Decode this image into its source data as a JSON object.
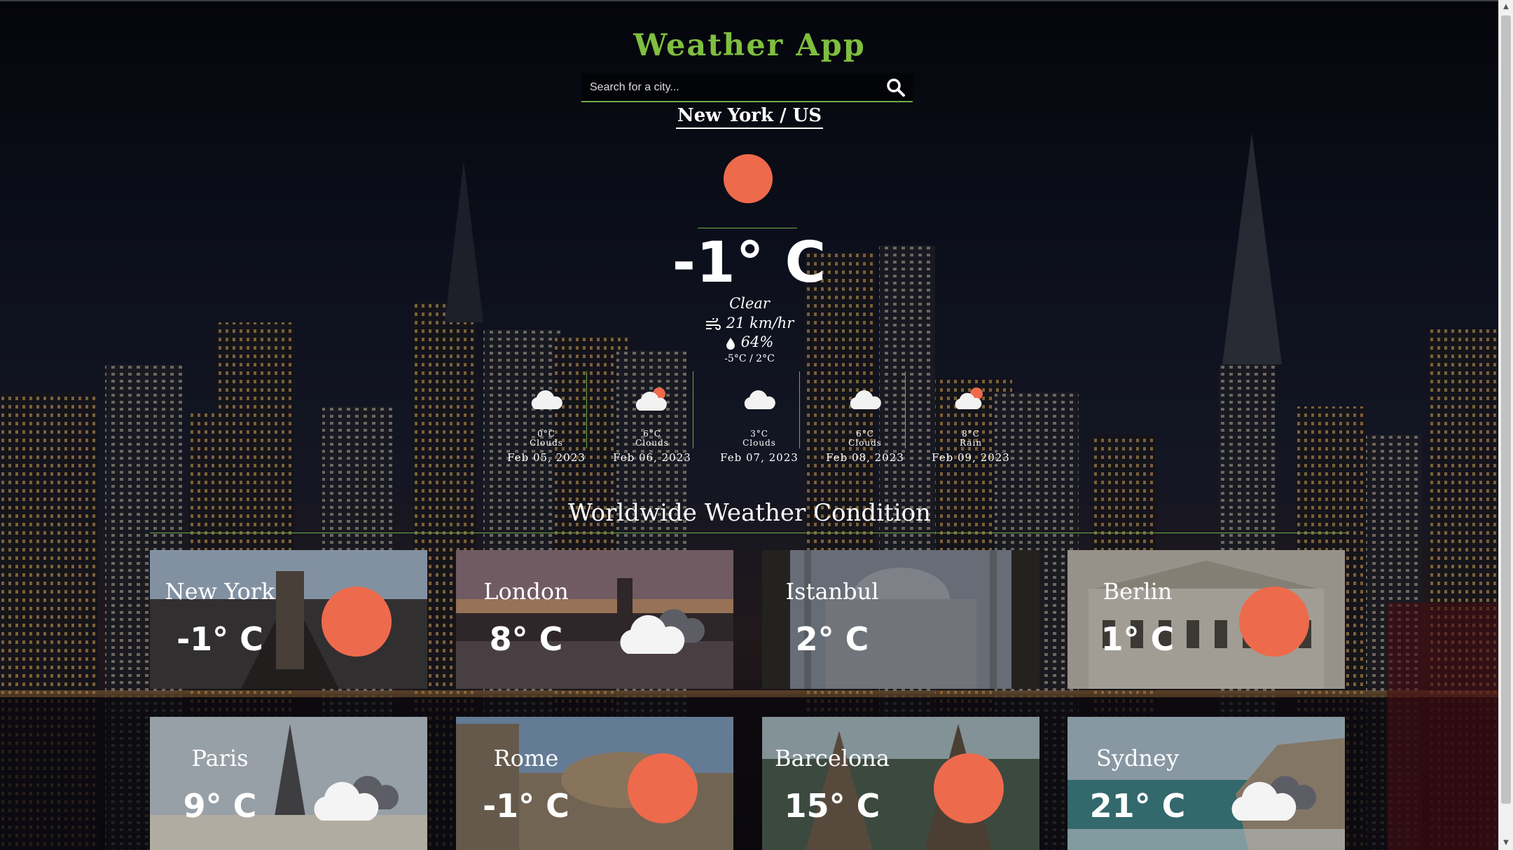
{
  "header": {
    "title": "Weather App"
  },
  "search": {
    "placeholder": "Search for a city..."
  },
  "current": {
    "location": "New York / US",
    "icon": "sun-icon",
    "temperature": "-1° C",
    "description": "Clear",
    "wind": "21 km/hr",
    "humidity": "64%",
    "range": "-5°C / 2°C"
  },
  "forecast": [
    {
      "temp": "0°C",
      "desc": "Clouds",
      "date": "Feb 05, 2023",
      "icon": "cloud-icon"
    },
    {
      "temp": "6°C",
      "desc": "Clouds",
      "date": "Feb 06, 2023",
      "icon": "cloud-sun-icon"
    },
    {
      "temp": "3°C",
      "desc": "Clouds",
      "date": "Feb 07, 2023",
      "icon": "cloud-icon"
    },
    {
      "temp": "6°C",
      "desc": "Clouds",
      "date": "Feb 08, 2023",
      "icon": "cloud-icon"
    },
    {
      "temp": "8°C",
      "desc": "Rain",
      "date": "Feb 09, 2023",
      "icon": "cloud-sun-icon"
    }
  ],
  "worldwide": {
    "title": "Worldwide Weather Condition",
    "cities": [
      {
        "name": "New York",
        "temp": "-1° C",
        "icon": "sun-icon"
      },
      {
        "name": "London",
        "temp": "8° C",
        "icon": "clouds-icon"
      },
      {
        "name": "Istanbul",
        "temp": "2° C",
        "icon": ""
      },
      {
        "name": "Berlin",
        "temp": "1° C",
        "icon": "sun-icon"
      },
      {
        "name": "Paris",
        "temp": "9° C",
        "icon": "clouds-icon"
      },
      {
        "name": "Rome",
        "temp": "-1° C",
        "icon": "sun-icon"
      },
      {
        "name": "Barcelona",
        "temp": "15° C",
        "icon": "sun-icon"
      },
      {
        "name": "Sydney",
        "temp": "21° C",
        "icon": "clouds-icon"
      }
    ]
  },
  "colors": {
    "accent": "#7fbf3f",
    "sun": "#ee6a4c",
    "line": "#6fae44"
  }
}
